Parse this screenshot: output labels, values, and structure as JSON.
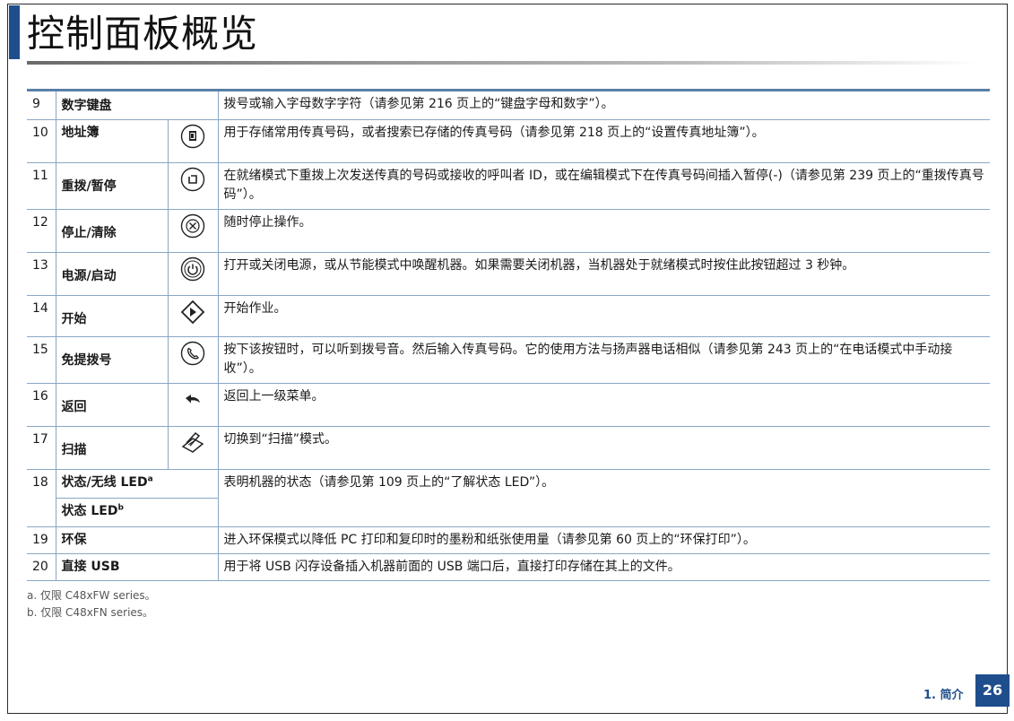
{
  "page": {
    "title": "控制面板概览",
    "section": "1. 简介",
    "number": "26"
  },
  "rows": [
    {
      "num": "9",
      "name": "数字键盘",
      "desc": "拨号或输入字母数字字符（请参见第 216 页上的“键盘字母和数字”）。"
    },
    {
      "num": "10",
      "name": "地址簿",
      "icon": "address-book-icon",
      "desc": "用于存储常用传真号码，或者搜索已存储的传真号码（请参见第 218 页上的“设置传真地址簿”）。"
    },
    {
      "num": "11",
      "name": "重拨/暂停",
      "icon": "redial-pause-icon",
      "desc": "在就绪模式下重拨上次发送传真的号码或接收的呼叫者 ID，或在编辑模式下在传真号码间插入暂停(-)（请参见第 239 页上的“重拨传真号码”）。"
    },
    {
      "num": "12",
      "name": "停止/清除",
      "icon": "stop-clear-icon",
      "desc": "随时停止操作。"
    },
    {
      "num": "13",
      "name": "电源/启动",
      "icon": "power-icon",
      "desc": "打开或关闭电源，或从节能模式中唤醒机器。如果需要关闭机器，当机器处于就绪模式时按住此按钮超过 3 秒钟。"
    },
    {
      "num": "14",
      "name": "开始",
      "icon": "start-icon",
      "desc": "开始作业。"
    },
    {
      "num": "15",
      "name": "免提拨号",
      "icon": "on-hook-dial-icon",
      "desc": "按下该按钮时，可以听到拨号音。然后输入传真号码。它的使用方法与扬声器电话相似（请参见第 243 页上的“在电话模式中手动接收”）。"
    },
    {
      "num": "16",
      "name": "返回",
      "icon": "back-icon",
      "desc": "返回上一级菜单。"
    },
    {
      "num": "17",
      "name": "扫描",
      "icon": "scan-icon",
      "desc": "切换到“扫描”模式。"
    },
    {
      "num": "18",
      "name_a": "状态/无线 LED",
      "sup_a": "a",
      "name_b": "状态 LED",
      "sup_b": "b",
      "desc": "表明机器的状态（请参见第 109 页上的“了解状态 LED”）。"
    },
    {
      "num": "19",
      "name": "环保",
      "desc": "进入环保模式以降低 PC 打印和复印时的墨粉和纸张使用量（请参见第 60 页上的“环保打印”）。"
    },
    {
      "num": "20",
      "name": "直接 USB",
      "desc": "用于将 USB 闪存设备插入机器前面的 USB 端口后，直接打印存储在其上的文件。"
    }
  ],
  "footnotes": {
    "a": "a. 仅限 C48xFW series。",
    "b": "b. 仅限 C48xFN series。"
  },
  "colors": {
    "accent": "#1f4e8c",
    "rule": "#8aa6c4"
  }
}
